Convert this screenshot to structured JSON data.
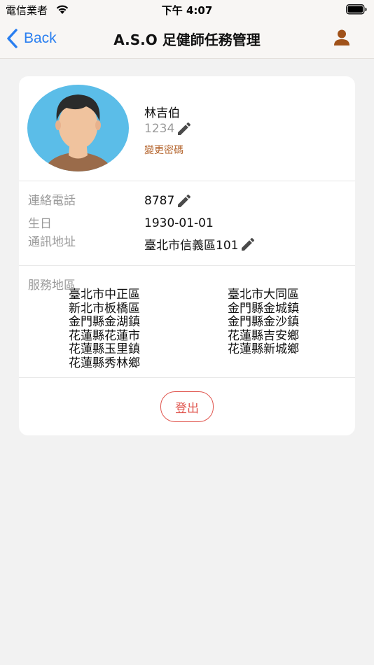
{
  "status_bar": {
    "carrier": "電信業者",
    "time": "下午 4:07"
  },
  "nav": {
    "back_label": "Back",
    "title": "A.S.O 足健師任務管理",
    "accent_color": "#2a7ff0",
    "brand_color": "#a0521a"
  },
  "profile": {
    "name": "林吉伯",
    "id": "1234",
    "change_password": "變更密碼"
  },
  "fields": {
    "phone_label": "連絡電話",
    "phone_value": "8787",
    "birthday_label": "生日",
    "birthday_value": "1930-01-01",
    "address_label": "通訊地址",
    "address_value": "臺北市信義區101"
  },
  "service_areas": {
    "label": "服務地區",
    "left": [
      "臺北市中正區",
      "新北市板橋區",
      "金門縣金湖鎮",
      "花蓮縣花蓮市",
      "花蓮縣玉里鎮",
      "花蓮縣秀林鄉"
    ],
    "right": [
      "臺北市大同區",
      "金門縣金城鎮",
      "金門縣金沙鎮",
      "花蓮縣吉安鄉",
      "花蓮縣新城鄉"
    ]
  },
  "logout_label": "登出"
}
